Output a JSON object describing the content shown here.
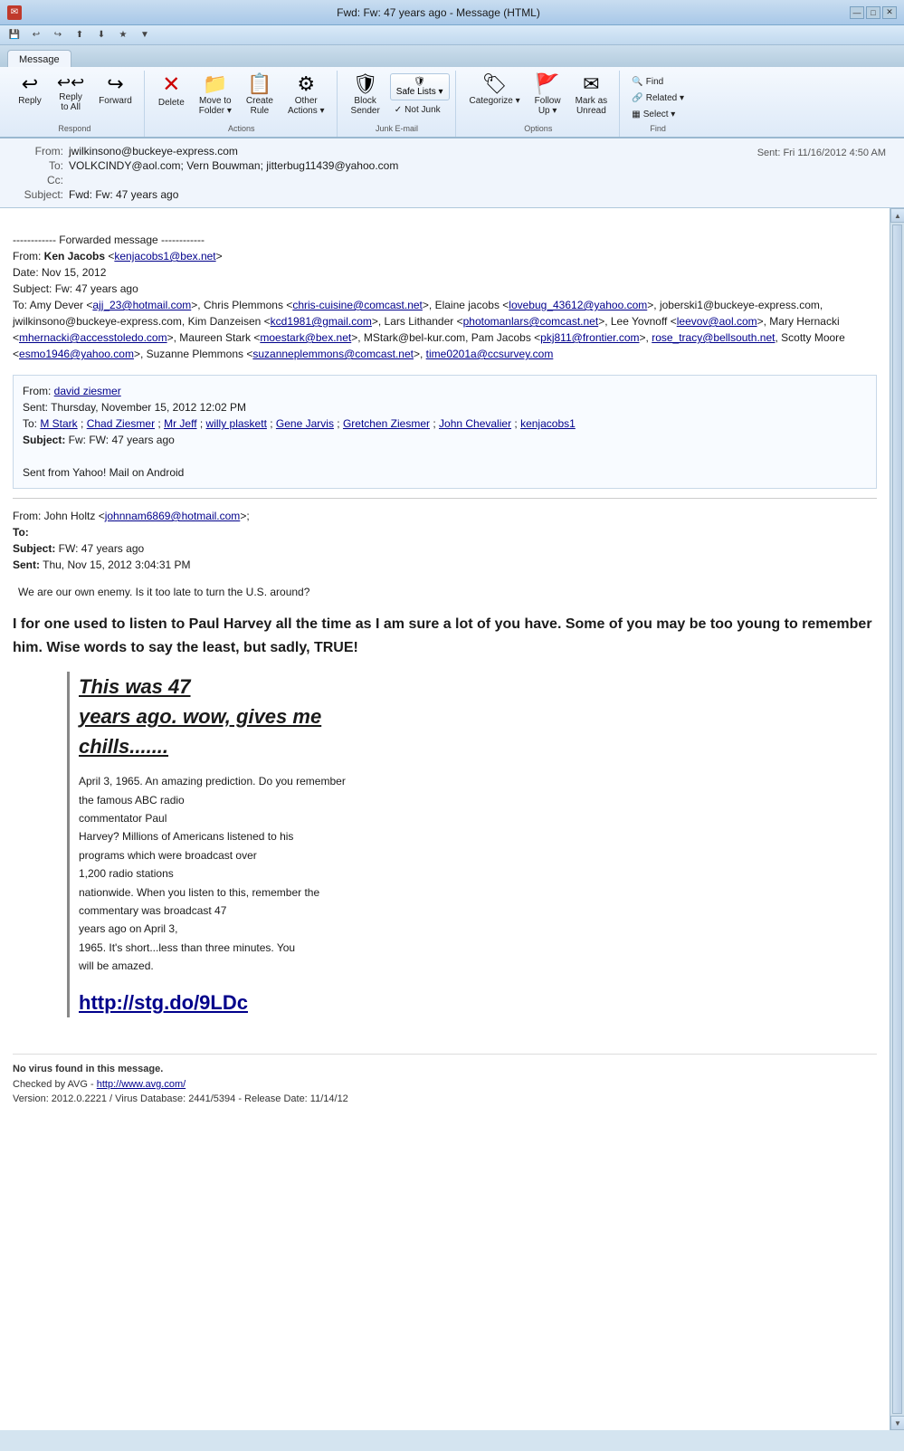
{
  "window": {
    "title": "Fwd: Fw: 47 years ago - Message (HTML)",
    "tab_label": "Message",
    "help_icon": "❓",
    "min": "—",
    "max": "□",
    "close": "✕"
  },
  "quick_toolbar": {
    "buttons": [
      "💾",
      "↩",
      "↪",
      "⬆",
      "⬇",
      "★",
      "▼"
    ]
  },
  "ribbon": {
    "groups": [
      {
        "label": "Respond",
        "buttons_large": [
          {
            "id": "reply",
            "icon": "↩",
            "label": "Reply"
          },
          {
            "id": "reply-all",
            "icon": "↩↩",
            "label": "Reply\nto All"
          },
          {
            "id": "forward",
            "icon": "↪",
            "label": "Forward"
          }
        ]
      },
      {
        "label": "Actions",
        "buttons_large": [
          {
            "id": "delete",
            "icon": "✕",
            "label": "Delete"
          },
          {
            "id": "move-to-folder",
            "icon": "📁",
            "label": "Move to\nFolder ▾"
          },
          {
            "id": "create-rule",
            "icon": "📋",
            "label": "Create\nRule"
          },
          {
            "id": "other-actions",
            "icon": "⚙",
            "label": "Other\nActions ▾"
          }
        ]
      },
      {
        "label": "Junk E-mail",
        "buttons_large": [
          {
            "id": "block-sender",
            "icon": "🛡",
            "label": "Block\nSender"
          },
          {
            "id": "not-junk",
            "icon": "✓",
            "label": "Not Junk"
          }
        ],
        "safe_lists_label": "Safe Lists ▾"
      },
      {
        "label": "Options",
        "buttons_large": [
          {
            "id": "categorize",
            "icon": "🏷",
            "label": "Categorize ▾"
          },
          {
            "id": "follow-up",
            "icon": "🚩",
            "label": "Follow\nUp ▾"
          },
          {
            "id": "mark-as-unread",
            "icon": "✉",
            "label": "Mark as\nUnread"
          }
        ]
      },
      {
        "label": "Find",
        "buttons_stacked": [
          {
            "id": "find",
            "icon": "🔍",
            "label": "Find"
          },
          {
            "id": "related",
            "icon": "🔗",
            "label": "Related ▾"
          },
          {
            "id": "select",
            "icon": "▦",
            "label": "Select ▾"
          }
        ]
      }
    ]
  },
  "email": {
    "from": "jwilkinsono@buckeye-express.com",
    "sent_label": "Sent:",
    "sent_value": "Fri 11/16/2012 4:50 AM",
    "to": "VOLKCINDY@aol.com; Vern Bouwman; jitterbug11439@yahoo.com",
    "cc": "",
    "subject": "Fwd: Fw: 47 years ago",
    "body_parts": [
      {
        "type": "forwarded_header",
        "separator": "------------ Forwarded message ------------",
        "from": "From: <b>Ken Jacobs</b> &lt;<a href='mailto:kenjacobs1@bex.net'>kenjacobs1@bex.net</a>&gt;",
        "date": "Date: Nov 15, 2012",
        "subject": "Subject: Fw: 47 years ago",
        "to_line": "To: Amy Dever &lt;<a href='mailto:ajj_23@hotmail.com'>ajj_23@hotmail.com</a>&gt;, Chris Plemmons &lt;<a href='mailto:chris-cuisine@comcast.net'>chris-cuisine@comcast.net</a>&gt;, Elaine jacobs &lt;<a href='mailto:lovebug_43612@yahoo.com'>lovebug_43612@yahoo.com</a>&gt;, joberski1@buckeye-express.com, jwilkinsono@buckeye-express.com, Kim Danzeisen &lt;<a href='mailto:kcd1981@gmail.com'>kcd1981@gmail.com</a>&gt;, Lars Lithander &lt;<a href='mailto:photomanlars@comcast.net'>photomanlars@comcast.net</a>&gt;, Lee Yovnoff &lt;<a href='mailto:leevov@aol.com'>leevov@aol.com</a>&gt;, Mary Hernacki &lt;<a href='mailto:mhernacki@accesstoledo.com'>mhernacki@accesstoledo.com</a>&gt;, Maureen Stark &lt;<a href='mailto:moestark@bex.net'>moestark@bex.net</a>&gt;, MStark@bel-kur.com, Pam Jacobs &lt;<a href='mailto:pkj811@frontier.com'>pkj811@frontier.com</a>&gt;, <a href='mailto:rose_tracy@bellsouth.net'>rose_tracy@bellsouth.net</a>, Scotty Moore &lt;<a href='mailto:esmo1946@yahoo.com'>esmo1946@yahoo.com</a>&gt;, Suzanne Plemmons &lt;<a href='mailto:suzanneplemmons@comcast.net'>suzanneplemmons@comcast.net</a>&gt;, <a href='mailto:time0201a@ccsurvey.com'>time0201a@ccsurvey.com</a>"
      },
      {
        "type": "inner_forward",
        "from": "david ziesmer",
        "from_email": "david ziesmer",
        "sent": "Thursday, November 15, 2012 12:02 PM",
        "to_links": "M Stark ; Chad Ziesmer ; Mr Jeff ; willy plaskett ; Gene Jarvis ; Gretchen Ziesmer ; John Chevalier ; kenjacobs1",
        "subject": "Fw: FW: 47 years ago",
        "body": "Sent from Yahoo! Mail on Android"
      },
      {
        "type": "inner_forward2",
        "from": "John Holtz",
        "from_email": "johnnam6869@hotmail.com",
        "to": "",
        "subject": "FW: 47 years ago",
        "sent": "Thu, Nov 15, 2012 3:04:31 PM",
        "intro": "We are our own enemy. Is it too late to turn the U.S. around?",
        "big_intro": "I for one used to listen to Paul Harvey all the time as I am sure a lot of you have.  Some of you may be too young to remember him.  Wise words to say the least, but sadly, TRUE!",
        "indented": {
          "heading": "This was 47 years ago. wow, gives me chills.......",
          "body": "April 3, 1965. An amazing prediction. Do you remember the famous ABC radio commentator Paul Harvey? Millions of Americans listened to his programs which were broadcast over 1,200 radio stations nationwide. When you listen to this, remember the commentary was broadcast 47 years ago on April 3, 1965.  It's short...less than three minutes. You will be amazed.",
          "link": "http://stg.do/9LDc"
        },
        "footer": "No virus found in this message.\nChecked by AVG - http://www.avg.com/\nVersion: 2012.0.2221 / Virus Database: 2441/5394 - Release Date: 11/14/12"
      }
    ]
  }
}
